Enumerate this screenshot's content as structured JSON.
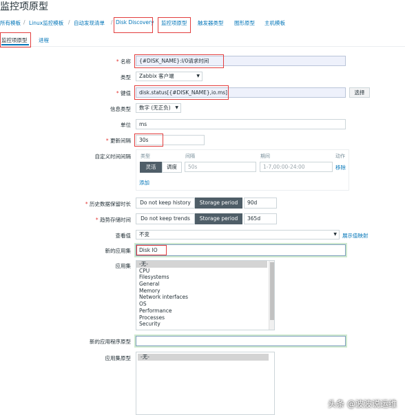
{
  "page": {
    "title": "监控项原型"
  },
  "breadcrumb": {
    "items": [
      "所有模板",
      "Linux监控模板",
      "自动发现清单",
      "Disk Discovery",
      "监控项原型",
      "触发器类型",
      "图形原型",
      "主机模板"
    ],
    "separator": "/"
  },
  "tabs": [
    "监控项原型",
    "进程"
  ],
  "form": {
    "name": {
      "label": "名称",
      "value": "{#DISK_NAME}:I/0请求时间"
    },
    "type": {
      "label": "类型",
      "value": "Zabbix 客户端"
    },
    "key": {
      "label": "键值",
      "value": "disk.status[{#DISK_NAME},io.ms]",
      "select_button": "选择"
    },
    "info_type": {
      "label": "信息类型",
      "value": "数字 (无正负)"
    },
    "units": {
      "label": "单位",
      "value": "ms"
    },
    "update_interval": {
      "label": "更新间隔",
      "value": "30s"
    },
    "custom_intervals": {
      "label": "自定义时间间隔",
      "headers": {
        "type": "类型",
        "interval": "间隔",
        "period": "期间",
        "action": "动作"
      },
      "row": {
        "flexible": "灵活",
        "scheduling": "调度",
        "interval_placeholder": "50s",
        "period_placeholder": "1-7,00:00-24:00",
        "remove": "移除"
      },
      "add": "添加"
    },
    "history": {
      "label": "历史数据保留时长",
      "option_a": "Do not keep history",
      "option_b": "Storage period",
      "value": "90d"
    },
    "trends": {
      "label": "趋势存储时间",
      "option_a": "Do not keep trends",
      "option_b": "Storage period",
      "value": "365d"
    },
    "show_value": {
      "label": "查看值",
      "value": "不变",
      "link": "展示值映射"
    },
    "new_application": {
      "label": "新的应用集",
      "value": "Disk IO"
    },
    "applications": {
      "label": "应用集",
      "options": [
        "-无-",
        "CPU",
        "Filesystems",
        "General",
        "Memory",
        "Network interfaces",
        "OS",
        "Performance",
        "Processes",
        "Security"
      ],
      "selected": "-无-"
    },
    "new_app_prototype": {
      "label": "新的应用程序原型",
      "value": ""
    },
    "app_prototypes": {
      "label": "应用集原型",
      "options": [
        "-无-"
      ],
      "selected": "-无-"
    }
  },
  "watermark": "头条 @波波说运维"
}
